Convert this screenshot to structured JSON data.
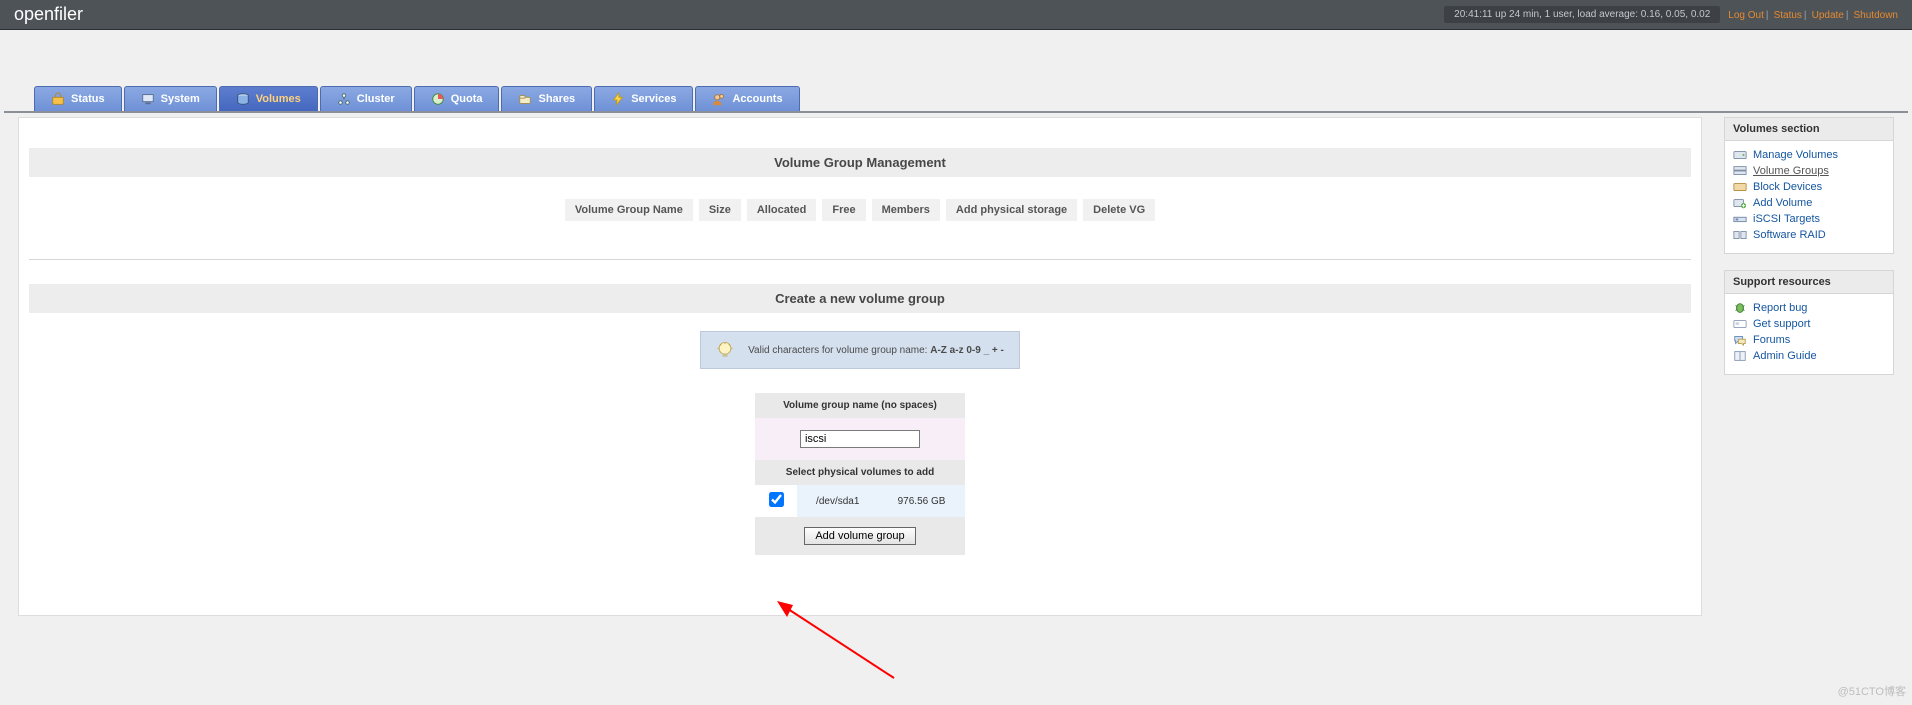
{
  "topbar": {
    "brand": "openfiler",
    "status": "20:41:11 up 24 min, 1 user, load average: 0.16, 0.05, 0.02",
    "links": {
      "logout": "Log Out",
      "status": "Status",
      "update": "Update",
      "shutdown": "Shutdown"
    }
  },
  "tabs": [
    {
      "key": "status",
      "label": "Status"
    },
    {
      "key": "system",
      "label": "System"
    },
    {
      "key": "volumes",
      "label": "Volumes",
      "active": true
    },
    {
      "key": "cluster",
      "label": "Cluster"
    },
    {
      "key": "quota",
      "label": "Quota"
    },
    {
      "key": "shares",
      "label": "Shares"
    },
    {
      "key": "services",
      "label": "Services"
    },
    {
      "key": "accounts",
      "label": "Accounts"
    }
  ],
  "vg_mgmt": {
    "title": "Volume Group Management",
    "columns": [
      "Volume Group Name",
      "Size",
      "Allocated",
      "Free",
      "Members",
      "Add physical storage",
      "Delete VG"
    ]
  },
  "create_vg": {
    "title": "Create a new volume group",
    "hint_a": "Valid characters for volume group name: ",
    "hint_b": "A-Z a-z 0-9 _ + -",
    "name_header": "Volume group name (no spaces)",
    "name_value": "iscsi",
    "select_header": "Select physical volumes to add",
    "pv": {
      "checked": true,
      "dev": "/dev/sda1",
      "size": "976.56 GB"
    },
    "submit": "Add volume group"
  },
  "side_volumes": {
    "title": "Volumes section",
    "items": [
      {
        "key": "manage",
        "label": "Manage Volumes"
      },
      {
        "key": "groups",
        "label": "Volume Groups",
        "current": true
      },
      {
        "key": "block",
        "label": "Block Devices"
      },
      {
        "key": "addvol",
        "label": "Add Volume"
      },
      {
        "key": "iscsi",
        "label": "iSCSI Targets"
      },
      {
        "key": "raid",
        "label": "Software RAID"
      }
    ]
  },
  "side_support": {
    "title": "Support resources",
    "items": [
      {
        "key": "bug",
        "label": "Report bug"
      },
      {
        "key": "support",
        "label": "Get support"
      },
      {
        "key": "forums",
        "label": "Forums"
      },
      {
        "key": "guide",
        "label": "Admin Guide"
      }
    ]
  },
  "watermark": "@51CTO博客"
}
